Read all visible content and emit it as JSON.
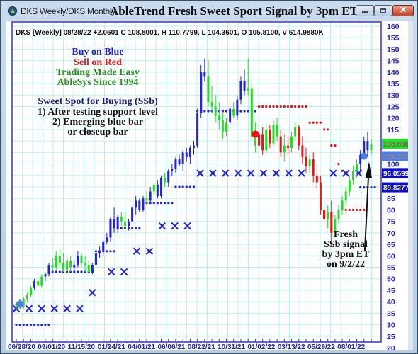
{
  "window": {
    "app_title": "DKS Weekly/DKS Monthly",
    "chart_heading": "AbleTrend Fresh Sweet Sport Signal by 3pm ET",
    "controls": {
      "minimize": "minimize",
      "maximize": "maximize",
      "close": "✕"
    }
  },
  "info_line": "DKS [Weekly] 08/28/22  +2.0601 C 108.8001, H 110.7799, L 104.3601, O 105.8100, V 614.9880K",
  "annotations": {
    "buy": "Buy on Blue",
    "sell": "Sell on Red",
    "tagline": "Trading Made Easy",
    "since": "AbleSys Since 1994",
    "ssb_title": "Sweet Spot for Buying (SSb)",
    "ssb_rule1": "1) After testing support level",
    "ssb_rule2a": "2) Emerging blue bar",
    "ssb_rule2b": "or closeup bar",
    "fresh1": "Fresh",
    "fresh2": "SSb signal",
    "fresh3": "by 3pm ET",
    "fresh4": "on 9/2/22"
  },
  "price_boxes": [
    {
      "label": "108.800",
      "value": 108.8,
      "bg": "#22e022",
      "fg": "#7a5a5a"
    },
    {
      "label": "103.397",
      "value": 103.397,
      "bg": "#4f7fe6",
      "fg": "#8a8a8a"
    },
    {
      "label": "96.0599",
      "value": 96.0599,
      "bg": "#0a0ad0",
      "fg": "#ffffff"
    },
    {
      "label": "89.8277",
      "value": 89.8277,
      "bg": "#0a0ad0",
      "fg": "#f0f080"
    }
  ],
  "colors": {
    "blue": "#2323d6",
    "green": "#22dd22",
    "red": "#ee1111",
    "grid": "#bdf0f4",
    "axis": "#3333cc"
  },
  "chart_data": {
    "type": "candlestick",
    "title": "AbleTrend Fresh Sweet Sport Signal by 3pm ET",
    "symbol": "DKS",
    "interval": "Weekly",
    "ylim": [
      20,
      160
    ],
    "yticks": [
      160,
      155,
      150,
      145,
      140,
      135,
      130,
      125,
      120,
      115,
      110,
      105,
      100,
      95,
      90,
      85,
      80,
      75,
      70,
      65,
      60,
      55,
      50,
      45,
      40,
      35,
      30,
      25,
      20
    ],
    "ytick_labels_shown": [
      "160",
      "155",
      "150",
      "145",
      "140",
      "135",
      "130",
      "125",
      "120",
      "115",
      "100",
      "85",
      "80",
      "75",
      "70",
      "65",
      "60",
      "55",
      "50",
      "45",
      "40",
      "35",
      "30",
      "25",
      "20"
    ],
    "xtick_labels": [
      "06/28/20",
      "09/01/20",
      "11/15/20",
      "01/24/21",
      "04/01/21",
      "06/06/21",
      "08/22/21",
      "10/31/21",
      "01/02/22",
      "03/13/22",
      "05/29/22",
      "08/01/22"
    ],
    "last_bar": {
      "date": "08/28/22",
      "change": 2.0601,
      "close": 108.8001,
      "high": 110.7799,
      "low": 104.3601,
      "open": 105.81,
      "volume": "614.9880K"
    },
    "bars": [
      [
        38,
        40,
        36,
        39,
        "g"
      ],
      [
        39,
        41,
        37,
        38,
        "b"
      ],
      [
        38,
        42,
        37,
        41,
        "g"
      ],
      [
        41,
        44,
        40,
        43,
        "g"
      ],
      [
        43,
        47,
        42,
        46,
        "g"
      ],
      [
        46,
        50,
        45,
        49,
        "b"
      ],
      [
        49,
        51,
        46,
        47,
        "g"
      ],
      [
        47,
        52,
        46,
        51,
        "g"
      ],
      [
        51,
        53,
        49,
        52,
        "b"
      ],
      [
        52,
        57,
        51,
        56,
        "b"
      ],
      [
        56,
        59,
        54,
        55,
        "g"
      ],
      [
        55,
        62,
        54,
        60,
        "g"
      ],
      [
        60,
        63,
        56,
        57,
        "g"
      ],
      [
        57,
        61,
        53,
        54,
        "g"
      ],
      [
        54,
        59,
        52,
        58,
        "g"
      ],
      [
        58,
        60,
        53,
        55,
        "g"
      ],
      [
        55,
        58,
        52,
        56,
        "b"
      ],
      [
        56,
        62,
        55,
        60,
        "b"
      ],
      [
        60,
        61,
        55,
        57,
        "g"
      ],
      [
        57,
        60,
        53,
        56,
        "g"
      ],
      [
        56,
        58,
        52,
        53,
        "g"
      ],
      [
        53,
        57,
        52,
        56,
        "b"
      ],
      [
        56,
        62,
        55,
        61,
        "b"
      ],
      [
        61,
        64,
        59,
        62,
        "b"
      ],
      [
        62,
        67,
        60,
        66,
        "b"
      ],
      [
        66,
        70,
        65,
        68,
        "b"
      ],
      [
        68,
        77,
        66,
        76,
        "b"
      ],
      [
        76,
        81,
        70,
        72,
        "b"
      ],
      [
        72,
        78,
        70,
        77,
        "b"
      ],
      [
        77,
        79,
        73,
        75,
        "g"
      ],
      [
        75,
        79,
        72,
        73,
        "g"
      ],
      [
        73,
        76,
        71,
        75,
        "b"
      ],
      [
        75,
        82,
        74,
        81,
        "b"
      ],
      [
        81,
        86,
        78,
        84,
        "b"
      ],
      [
        84,
        85,
        79,
        80,
        "b"
      ],
      [
        80,
        86,
        79,
        85,
        "b"
      ],
      [
        85,
        88,
        82,
        84,
        "g"
      ],
      [
        84,
        90,
        83,
        88,
        "b"
      ],
      [
        88,
        92,
        86,
        91,
        "g"
      ],
      [
        91,
        93,
        85,
        86,
        "b"
      ],
      [
        86,
        95,
        85,
        94,
        "b"
      ],
      [
        94,
        96,
        90,
        92,
        "g"
      ],
      [
        92,
        98,
        90,
        97,
        "b"
      ],
      [
        97,
        100,
        95,
        98,
        "b"
      ],
      [
        98,
        103,
        96,
        102,
        "b"
      ],
      [
        102,
        104,
        99,
        100,
        "b"
      ],
      [
        100,
        106,
        97,
        105,
        "b"
      ],
      [
        105,
        107,
        101,
        103,
        "b"
      ],
      [
        103,
        108,
        100,
        107,
        "b"
      ],
      [
        107,
        110,
        104,
        108,
        "b"
      ],
      [
        108,
        124,
        107,
        122,
        "b"
      ],
      [
        122,
        143,
        120,
        140,
        "b"
      ],
      [
        140,
        146,
        136,
        138,
        "b"
      ],
      [
        138,
        145,
        125,
        127,
        "g"
      ],
      [
        127,
        134,
        122,
        125,
        "g"
      ],
      [
        125,
        130,
        118,
        121,
        "g"
      ],
      [
        121,
        127,
        115,
        119,
        "g"
      ],
      [
        119,
        122,
        111,
        114,
        "g"
      ],
      [
        114,
        120,
        112,
        118,
        "g"
      ],
      [
        118,
        125,
        117,
        124,
        "b"
      ],
      [
        124,
        127,
        120,
        121,
        "g"
      ],
      [
        121,
        130,
        119,
        128,
        "b"
      ],
      [
        128,
        138,
        126,
        136,
        "b"
      ],
      [
        136,
        141,
        130,
        132,
        "b"
      ],
      [
        132,
        146,
        130,
        133,
        "g"
      ],
      [
        133,
        137,
        110,
        112,
        "g"
      ],
      [
        112,
        118,
        105,
        108,
        "g"
      ],
      [
        108,
        115,
        104,
        113,
        "r"
      ],
      [
        113,
        116,
        104,
        106,
        "r"
      ],
      [
        106,
        118,
        104,
        115,
        "g"
      ],
      [
        115,
        117,
        107,
        109,
        "r"
      ],
      [
        109,
        119,
        108,
        117,
        "g"
      ],
      [
        117,
        120,
        110,
        112,
        "g"
      ],
      [
        112,
        115,
        103,
        105,
        "r"
      ],
      [
        105,
        113,
        101,
        108,
        "g"
      ],
      [
        108,
        112,
        104,
        107,
        "r"
      ],
      [
        107,
        114,
        105,
        112,
        "g"
      ],
      [
        112,
        118,
        110,
        116,
        "g"
      ],
      [
        116,
        117,
        106,
        108,
        "r"
      ],
      [
        108,
        112,
        100,
        103,
        "r"
      ],
      [
        103,
        107,
        96,
        99,
        "r"
      ],
      [
        99,
        104,
        96,
        102,
        "g"
      ],
      [
        102,
        105,
        92,
        95,
        "r"
      ],
      [
        95,
        100,
        89,
        92,
        "r"
      ],
      [
        92,
        95,
        78,
        80,
        "r"
      ],
      [
        80,
        84,
        73,
        76,
        "r"
      ],
      [
        76,
        82,
        72,
        79,
        "g"
      ],
      [
        79,
        84,
        64,
        70,
        "r"
      ],
      [
        70,
        78,
        68,
        76,
        "g"
      ],
      [
        76,
        82,
        74,
        80,
        "g"
      ],
      [
        80,
        86,
        78,
        84,
        "g"
      ],
      [
        84,
        90,
        82,
        88,
        "g"
      ],
      [
        88,
        95,
        86,
        93,
        "g"
      ],
      [
        93,
        99,
        91,
        97,
        "g"
      ],
      [
        97,
        102,
        94,
        100,
        "g"
      ],
      [
        100,
        106,
        97,
        104,
        "b"
      ],
      [
        104,
        112,
        102,
        110,
        "b"
      ],
      [
        110,
        114,
        103,
        106,
        "b"
      ],
      [
        106,
        111,
        104,
        108.8,
        "g"
      ]
    ],
    "signals": {
      "blue_support_x_markers": "intermittent",
      "fresh_ssb_signal_date": "9/2/22",
      "fresh_ssb_price": 103.397
    }
  }
}
